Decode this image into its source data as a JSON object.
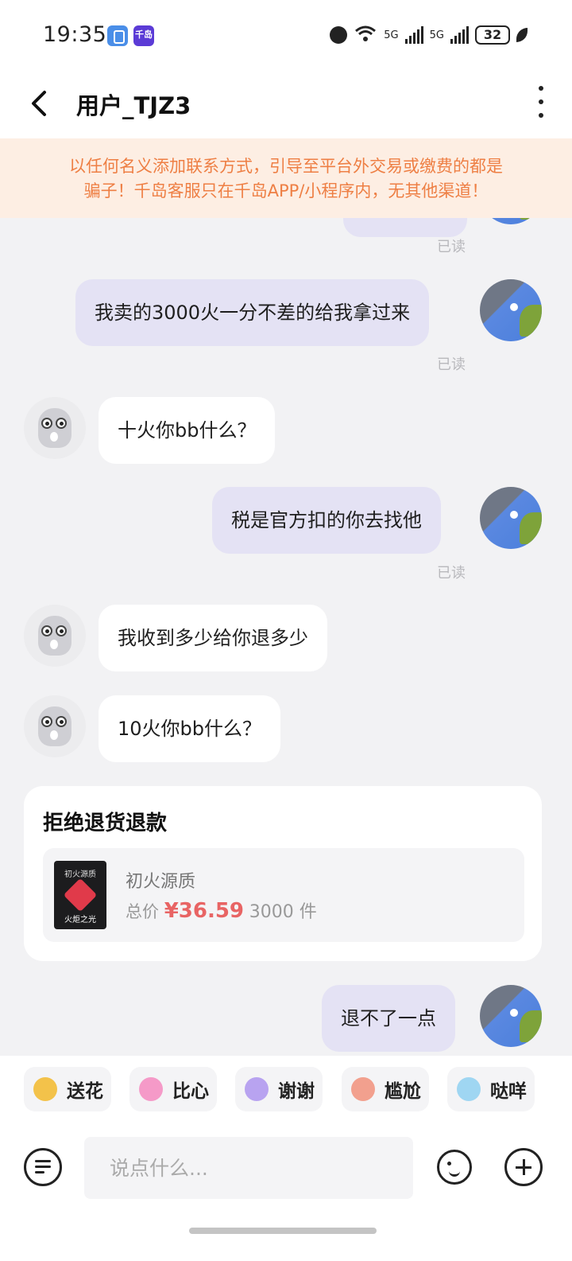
{
  "status_bar": {
    "time": "19:35",
    "app_icon_2_text": "千岛",
    "wifi_label": "6",
    "net1": "5G",
    "net2": "5G",
    "battery": "32"
  },
  "header": {
    "title": "用户_TJZ3"
  },
  "warning": {
    "line1": "以任何名义添加联系方式，引导至平台外交易或缴费的都是",
    "line2": "骗子！千岛客服只在千岛APP/小程序内，无其他渠道！"
  },
  "messages": {
    "read_label": "已读",
    "m1": "我卖的3000火一分不差的给我拿过来",
    "m2": "十火你bb什么？",
    "m3": "税是官方扣的你去找他",
    "m4": "我收到多少给你退多少",
    "m5": "10火你bb什么？",
    "m6": "退不了一点"
  },
  "order_card": {
    "title": "拒绝退货退款",
    "image_text_top": "初火源质",
    "image_text_bottom": "火炬之光",
    "product_name": "初火源质",
    "price_label": "总价",
    "price": "¥36.59",
    "quantity": "3000 件"
  },
  "quick_replies": [
    "送花",
    "比心",
    "谢谢",
    "尴尬",
    "哒咩"
  ],
  "quick_reply_icon_colors": [
    "#f3c24a",
    "#f59ac8",
    "#b8a3f0",
    "#f2a08e",
    "#9fd6f2"
  ],
  "input": {
    "placeholder": "说点什么..."
  },
  "colors": {
    "my_bubble": "#e4e2f4",
    "warning_text": "#ee7f44",
    "warning_bg": "#fdeee3",
    "price": "#e86464"
  }
}
